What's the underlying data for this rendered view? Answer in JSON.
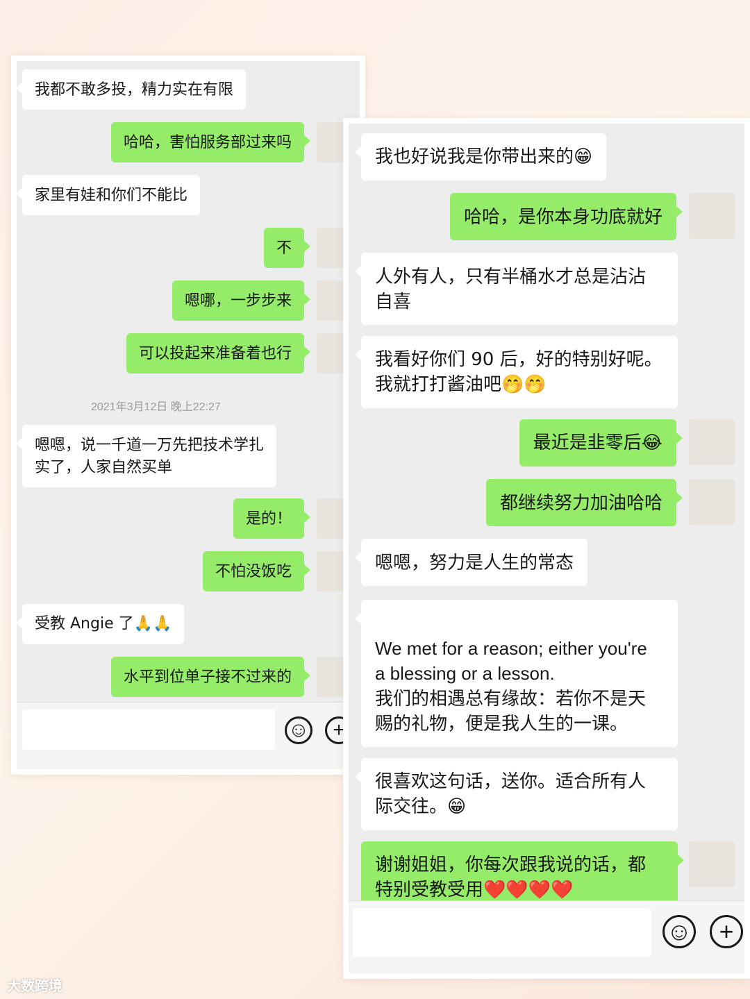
{
  "left_chat": {
    "messages": [
      {
        "dir": "in",
        "text": "我都不敢多投，精力实在有限"
      },
      {
        "dir": "out",
        "text": "哈哈，害怕服务部过来吗"
      },
      {
        "dir": "in",
        "text": "家里有娃和你们不能比"
      },
      {
        "dir": "out",
        "text": "不"
      },
      {
        "dir": "out",
        "text": "嗯哪，一步步来"
      },
      {
        "dir": "out",
        "text": "可以投起来准备着也行"
      },
      {
        "dir": "in",
        "text": "嗯嗯，说一千道一万先把技术学扎\n实了，人家自然买单"
      },
      {
        "dir": "out",
        "text": "是的！"
      },
      {
        "dir": "out",
        "text": "不怕没饭吃"
      },
      {
        "dir": "in",
        "text": "受教 Angie 了🙏🙏"
      },
      {
        "dir": "out",
        "text": "水平到位单子接不过来的"
      }
    ],
    "timestamp": "2021年3月12日 晚上22:27"
  },
  "right_chat": {
    "messages": [
      {
        "dir": "in",
        "text": "我也好说我是你带出来的😁"
      },
      {
        "dir": "out",
        "text": "哈哈，是你本身功底就好"
      },
      {
        "dir": "in",
        "text": "人外有人，只有半桶水才总是沾沾\n自喜"
      },
      {
        "dir": "in",
        "text": "我看好你们 90 后，好的特别好呢。\n我就打打酱油吧🤭🤭"
      },
      {
        "dir": "out",
        "text": "最近是韭零后😂"
      },
      {
        "dir": "out",
        "text": "都继续努力加油哈哈"
      },
      {
        "dir": "in",
        "text": "嗯嗯，努力是人生的常态"
      },
      {
        "dir": "in",
        "text": "\nWe met for a reason; either you're\na blessing or a lesson.\n我们的相遇总有缘故：若你不是天\n赐的礼物，便是我人生的一课。"
      },
      {
        "dir": "in",
        "text": "很喜欢这句话，送你。适合所有人\n际交往。😁"
      },
      {
        "dir": "out",
        "text": "谢谢姐姐，你每次跟我说的话，都\n特别受教受用❤️❤️❤️❤️"
      }
    ]
  },
  "icons": {
    "emoji_button": "smiley-face-icon",
    "plus_button": "plus-circle-icon",
    "emoji_glyph": "☺",
    "plus_glyph": "+"
  },
  "watermark": "大数跨境",
  "colors": {
    "outgoing": "#95ec69",
    "incoming": "#ffffff",
    "chat_bg": "#ededed"
  }
}
